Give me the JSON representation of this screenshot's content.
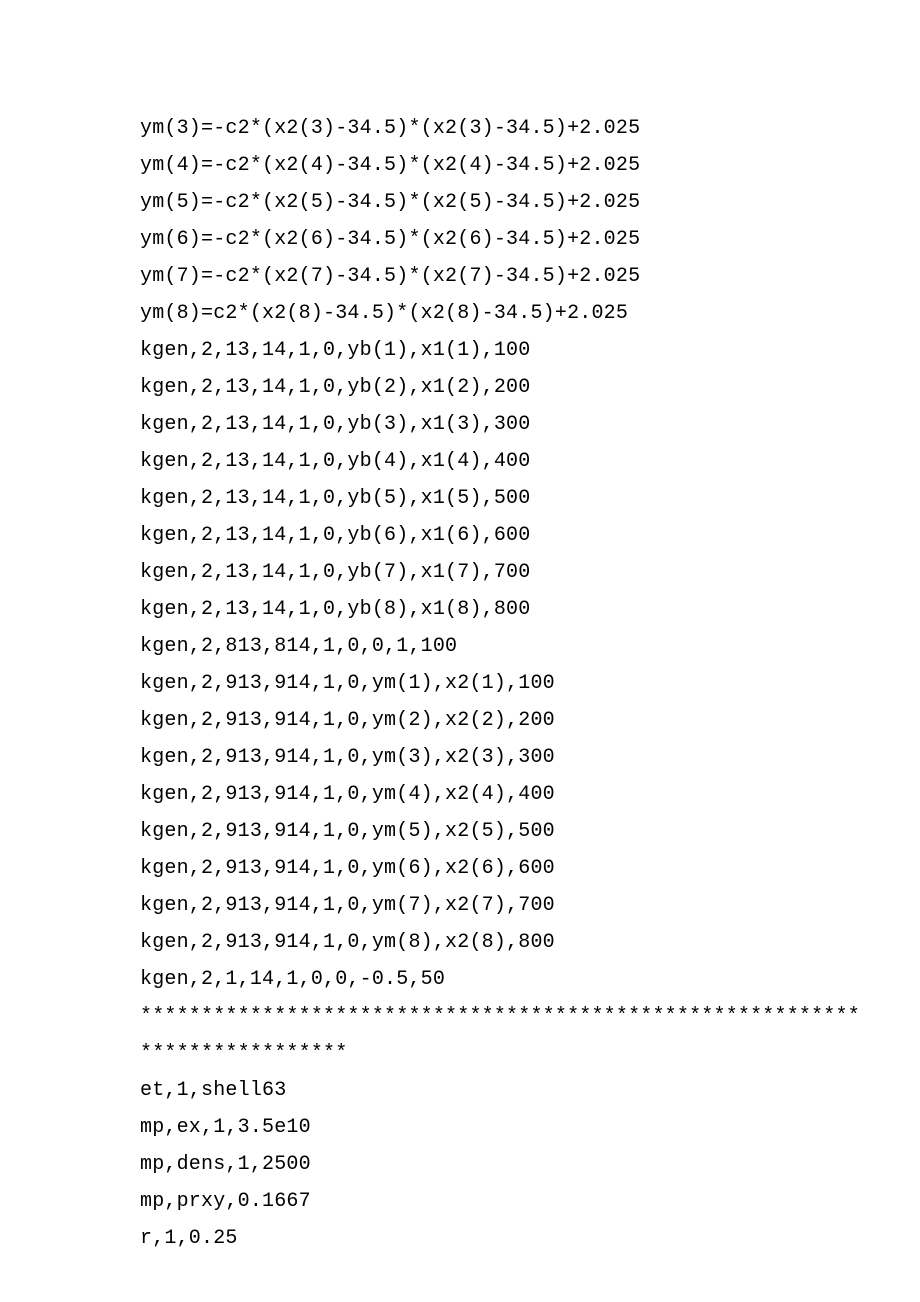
{
  "lines": [
    "ym(3)=-c2*(x2(3)-34.5)*(x2(3)-34.5)+2.025",
    "ym(4)=-c2*(x2(4)-34.5)*(x2(4)-34.5)+2.025",
    "ym(5)=-c2*(x2(5)-34.5)*(x2(5)-34.5)+2.025",
    "ym(6)=-c2*(x2(6)-34.5)*(x2(6)-34.5)+2.025",
    "ym(7)=-c2*(x2(7)-34.5)*(x2(7)-34.5)+2.025",
    "ym(8)=c2*(x2(8)-34.5)*(x2(8)-34.5)+2.025",
    "kgen,2,13,14,1,0,yb(1),x1(1),100",
    "kgen,2,13,14,1,0,yb(2),x1(2),200",
    "kgen,2,13,14,1,0,yb(3),x1(3),300",
    "kgen,2,13,14,1,0,yb(4),x1(4),400",
    "kgen,2,13,14,1,0,yb(5),x1(5),500",
    "kgen,2,13,14,1,0,yb(6),x1(6),600",
    "kgen,2,13,14,1,0,yb(7),x1(7),700",
    "kgen,2,13,14,1,0,yb(8),x1(8),800",
    "kgen,2,813,814,1,0,0,1,100",
    "kgen,2,913,914,1,0,ym(1),x2(1),100",
    "kgen,2,913,914,1,0,ym(2),x2(2),200",
    "kgen,2,913,914,1,0,ym(3),x2(3),300",
    "kgen,2,913,914,1,0,ym(4),x2(4),400",
    "kgen,2,913,914,1,0,ym(5),x2(5),500",
    "kgen,2,913,914,1,0,ym(6),x2(6),600",
    "kgen,2,913,914,1,0,ym(7),x2(7),700",
    "kgen,2,913,914,1,0,ym(8),x2(8),800",
    "kgen,2,1,14,1,0,0,-0.5,50",
    "***********************************************************",
    "*****************",
    "et,1,shell63",
    "mp,ex,1,3.5e10",
    "mp,dens,1,2500",
    "mp,prxy,0.1667",
    "r,1,0.25"
  ]
}
